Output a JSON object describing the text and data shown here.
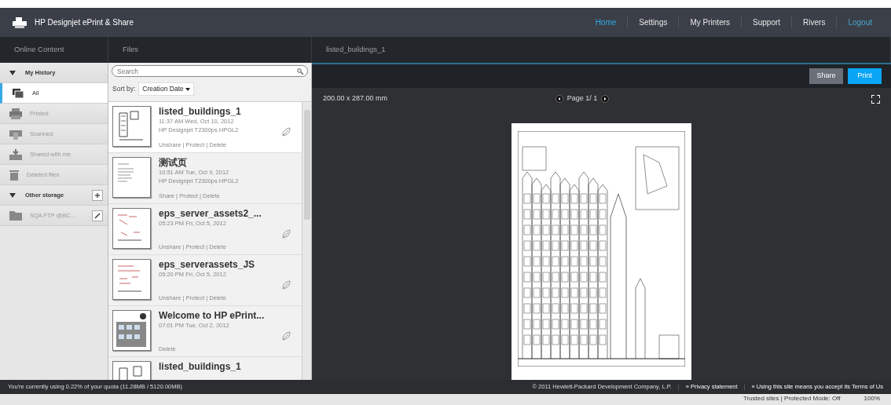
{
  "app": {
    "title": "HP Designjet ePrint & Share"
  },
  "nav": [
    {
      "label": "Home",
      "selected": true
    },
    {
      "label": "Settings",
      "selected": false
    },
    {
      "label": "My Printers",
      "selected": false
    },
    {
      "label": "Support",
      "selected": false
    },
    {
      "label": "Rivers",
      "selected": false
    },
    {
      "label": "Logout",
      "selected": false,
      "kind": "accent"
    }
  ],
  "panels": {
    "left": "Online Content",
    "middle": "Files",
    "right": "listed_buildings_1"
  },
  "sidebar": [
    {
      "kind": "section",
      "label": "My History",
      "expanded": true
    },
    {
      "kind": "item",
      "label": "All",
      "selected": true
    },
    {
      "kind": "item",
      "label": "Printed",
      "selected": false
    },
    {
      "kind": "item",
      "label": "Scanned",
      "selected": false
    },
    {
      "kind": "item",
      "label": "Shared with me",
      "selected": false
    },
    {
      "kind": "item",
      "label": "Deleted files",
      "selected": false
    },
    {
      "kind": "section",
      "label": "Other storage",
      "expanded": true,
      "add": true
    },
    {
      "kind": "storage",
      "label": "SQA FTP @BC...",
      "selected": false
    }
  ],
  "search": {
    "placeholder": "Search"
  },
  "sort": {
    "label": "Sort by:",
    "value": "Creation Date"
  },
  "files": [
    {
      "title": "listed_buildings_1",
      "date": "11:37 AM Wed, Oct 10, 2012",
      "printer": "HP Designjet T2300ps HPGL2",
      "actions": "Unshare | Protect | Delete",
      "shared": true,
      "selected": true
    },
    {
      "title": "测试页",
      "date": "10:51 AM Tue, Oct 9, 2012",
      "printer": "HP Designjet T2300ps HPGL2",
      "actions": "Share | Protect | Delete",
      "shared": false,
      "selected": false
    },
    {
      "title": "eps_server_assets2_...",
      "date": "05:23 PM Fri, Oct 5, 2012",
      "actions": "Unshare | Protect | Delete",
      "shared": true,
      "selected": false
    },
    {
      "title": "eps_serverassets_JS",
      "date": "05:20 PM Fri, Oct 5, 2012",
      "actions": "Unshare | Protect | Delete",
      "shared": true,
      "selected": false
    },
    {
      "title": "Welcome to HP ePrint...",
      "date": "07:01 PM Tue, Oct 2, 2012",
      "actions": "Delete",
      "shared": true,
      "selected": false
    },
    {
      "title": "listed_buildings_1",
      "selected": false
    }
  ],
  "viewer": {
    "buttons": [
      {
        "label": "Share",
        "kind": "secondary"
      },
      {
        "label": "Print",
        "kind": "primary"
      }
    ],
    "size": "200.00 x 287.00 mm",
    "page": "Page 1/ 1"
  },
  "footer": {
    "quota": "You're currently using 0.22% of your quota (11.28MB / 5120.00MB)",
    "items": [
      {
        "kind": "text",
        "text": "© 2011 Hewlett-Packard Development Company, L.P."
      },
      {
        "kind": "separator",
        "text": "|"
      },
      {
        "kind": "link",
        "text": "» Privacy statement"
      },
      {
        "kind": "separator",
        "text": "|"
      },
      {
        "kind": "link",
        "text": "» Using this site means you accept its Terms of Us"
      }
    ]
  },
  "browser_status": {
    "zone": "Trusted sites | Protected Mode: Off",
    "zoom": "100%"
  }
}
